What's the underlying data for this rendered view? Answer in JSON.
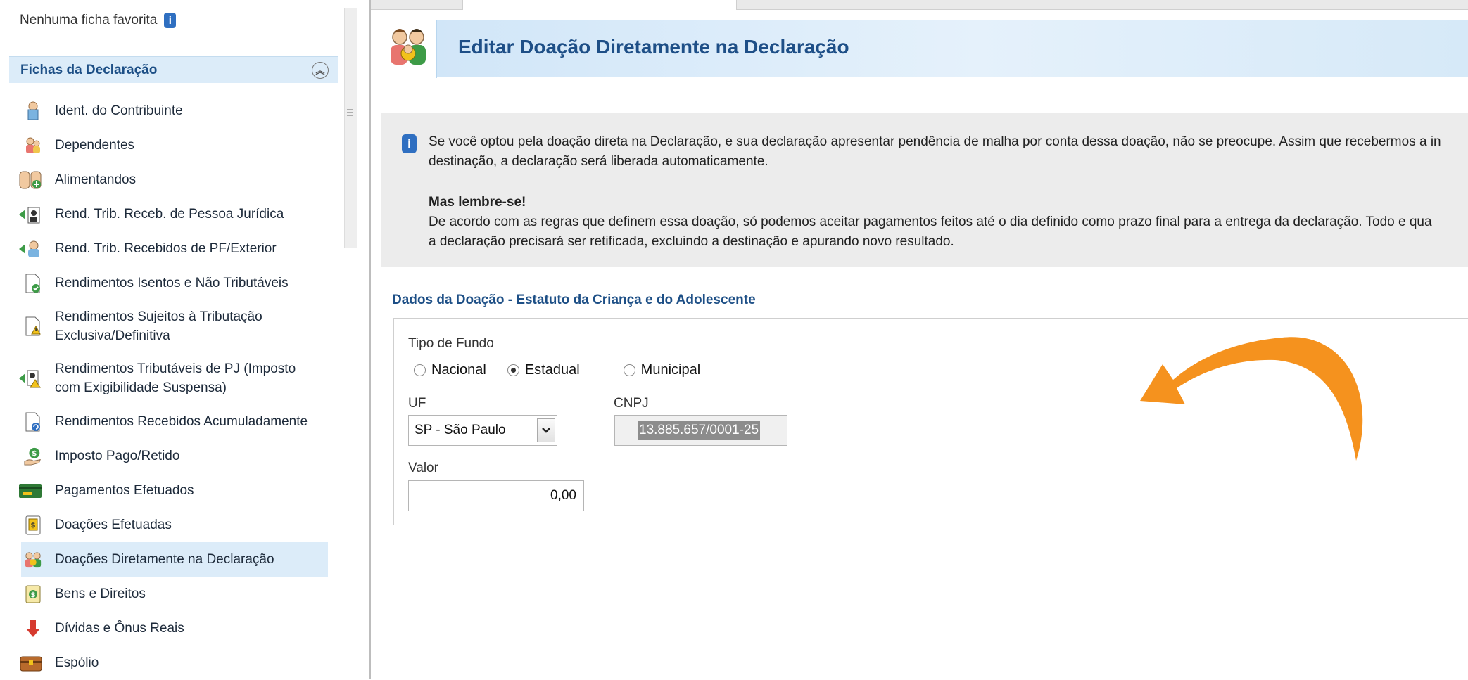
{
  "sidebar": {
    "favorites_text": "Nenhuma ficha favorita",
    "section_title": "Fichas da Declaração",
    "collapse_glyph": "«",
    "items": [
      {
        "label": "Ident. do Contribuinte",
        "icon": "person-icon"
      },
      {
        "label": "Dependentes",
        "icon": "dependents-icon"
      },
      {
        "label": "Alimentandos",
        "icon": "alimentandos-icon"
      },
      {
        "label": "Rend. Trib. Receb. de Pessoa Jurídica",
        "icon": "income-pj-icon"
      },
      {
        "label": "Rend. Trib. Recebidos de PF/Exterior",
        "icon": "income-pf-icon"
      },
      {
        "label": "Rendimentos Isentos e Não Tributáveis",
        "icon": "exempt-doc-icon"
      },
      {
        "label": "Rendimentos Sujeitos à Tributação Exclusiva/Definitiva",
        "icon": "warning-doc-icon"
      },
      {
        "label": "Rendimentos Tributáveis de PJ (Imposto com Exigibilidade Suspensa)",
        "icon": "suspended-tax-icon"
      },
      {
        "label": "Rendimentos Recebidos Acumuladamente",
        "icon": "accumulated-doc-icon"
      },
      {
        "label": "Imposto Pago/Retido",
        "icon": "tax-paid-icon"
      },
      {
        "label": "Pagamentos Efetuados",
        "icon": "card-icon"
      },
      {
        "label": "Doações Efetuadas",
        "icon": "donation-doc-icon"
      },
      {
        "label": "Doações Diretamente na Declaração",
        "icon": "donation-people-icon",
        "selected": true
      },
      {
        "label": "Bens e Direitos",
        "icon": "assets-icon"
      },
      {
        "label": "Dívidas e Ônus Reais",
        "icon": "debt-arrow-icon"
      },
      {
        "label": "Espólio",
        "icon": "chest-icon"
      }
    ]
  },
  "header": {
    "title": "Editar Doação Diretamente na Declaração"
  },
  "info": {
    "line1": "Se você optou pela doação direta na Declaração, e sua declaração apresentar pendência de malha por conta dessa doação, não se preocupe. Assim que recebermos a in",
    "line2": "destinação, a declaração será liberada automaticamente.",
    "heading": "Mas lembre-se!",
    "line3": "De acordo com as regras que definem essa doação, só podemos aceitar pagamentos feitos até o dia definido como prazo final para a entrega da declaração. Todo e qua",
    "line4": "a declaração precisará ser retificada, excluindo a destinação e apurando novo resultado."
  },
  "form": {
    "section_title": "Dados da Doação - Estatuto da Criança e do Adolescente",
    "fund_type_label": "Tipo de Fundo",
    "fund_options": [
      {
        "label": "Nacional",
        "selected": false
      },
      {
        "label": "Estadual",
        "selected": true
      },
      {
        "label": "Municipal",
        "selected": false
      }
    ],
    "uf_label": "UF",
    "uf_value": "SP - São Paulo",
    "cnpj_label": "CNPJ",
    "cnpj_value": "13.885.657/0001-25",
    "valor_label": "Valor",
    "valor_value": "0,00"
  },
  "colors": {
    "accent": "#1e4f87",
    "selected_bg": "#dcecf9",
    "annotation_arrow": "#f5921e",
    "info_icon": "#2f6fc1"
  }
}
